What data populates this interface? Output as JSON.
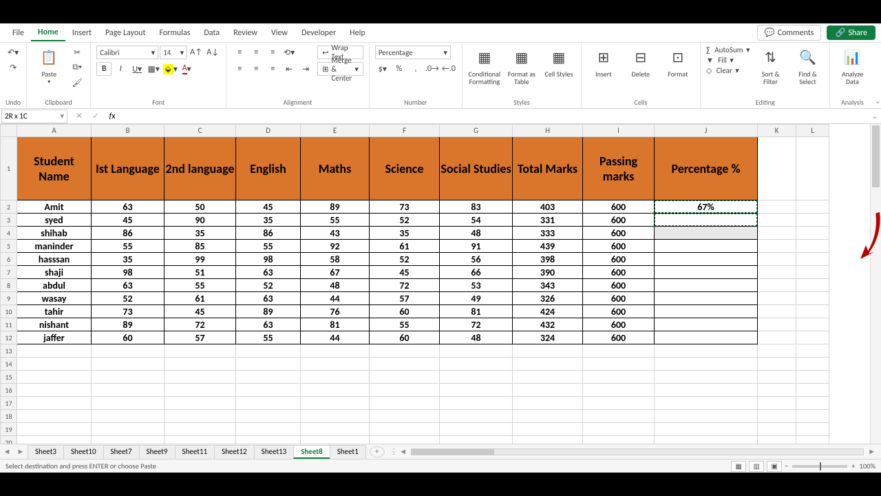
{
  "menu": {
    "tabs": [
      "File",
      "Home",
      "Insert",
      "Page Layout",
      "Formulas",
      "Data",
      "Review",
      "View",
      "Developer",
      "Help"
    ],
    "active": "Home",
    "comments": "Comments",
    "share": "Share"
  },
  "ribbon": {
    "groups": [
      "Undo",
      "Clipboard",
      "Font",
      "Alignment",
      "Number",
      "Styles",
      "Cells",
      "Editing",
      "Analysis"
    ],
    "paste": "Paste",
    "font_name": "Calibri",
    "font_size": "14",
    "wrap": "Wrap Text",
    "merge": "Merge & Center",
    "number_format": "Percentage",
    "cond": "Conditional Formatting",
    "fmtTable": "Format as Table",
    "cellStyles": "Cell Styles",
    "insert": "Insert",
    "delete": "Delete",
    "format": "Format",
    "autosum": "AutoSum",
    "fill": "Fill",
    "clear": "Clear",
    "sort": "Sort & Filter",
    "find": "Find & Select",
    "analyze": "Analyze Data"
  },
  "fx": {
    "namebox": "2R x 1C",
    "formula": ""
  },
  "columns_letters": [
    "A",
    "B",
    "C",
    "D",
    "E",
    "F",
    "G",
    "H",
    "I",
    "J",
    "K",
    "L"
  ],
  "headers": [
    "Student Name",
    "Ist Language",
    "2nd language",
    "English",
    "Maths",
    "Science",
    "Social Studies",
    "Total Marks",
    "Passing marks",
    "Percentage %"
  ],
  "rows": [
    {
      "n": "Amit",
      "l1": 63,
      "l2": 50,
      "en": 45,
      "ma": 89,
      "sc": 73,
      "ss": 83,
      "tot": 403,
      "pm": 600,
      "pct": "67%"
    },
    {
      "n": "syed",
      "l1": 45,
      "l2": 90,
      "en": 35,
      "ma": 55,
      "sc": 52,
      "ss": 54,
      "tot": 331,
      "pm": 600,
      "pct": ""
    },
    {
      "n": "shihab",
      "l1": 86,
      "l2": 35,
      "en": 86,
      "ma": 43,
      "sc": 35,
      "ss": 48,
      "tot": 333,
      "pm": 600,
      "pct": ""
    },
    {
      "n": "maninder",
      "l1": 55,
      "l2": 85,
      "en": 55,
      "ma": 92,
      "sc": 61,
      "ss": 91,
      "tot": 439,
      "pm": 600,
      "pct": ""
    },
    {
      "n": "hasssan",
      "l1": 35,
      "l2": 99,
      "en": 98,
      "ma": 58,
      "sc": 52,
      "ss": 56,
      "tot": 398,
      "pm": 600,
      "pct": ""
    },
    {
      "n": "shaji",
      "l1": 98,
      "l2": 51,
      "en": 63,
      "ma": 67,
      "sc": 45,
      "ss": 66,
      "tot": 390,
      "pm": 600,
      "pct": ""
    },
    {
      "n": "abdul",
      "l1": 63,
      "l2": 55,
      "en": 52,
      "ma": 48,
      "sc": 72,
      "ss": 53,
      "tot": 343,
      "pm": 600,
      "pct": ""
    },
    {
      "n": "wasay",
      "l1": 52,
      "l2": 61,
      "en": 63,
      "ma": 44,
      "sc": 57,
      "ss": 49,
      "tot": 326,
      "pm": 600,
      "pct": ""
    },
    {
      "n": "tahir",
      "l1": 73,
      "l2": 45,
      "en": 89,
      "ma": 76,
      "sc": 60,
      "ss": 81,
      "tot": 424,
      "pm": 600,
      "pct": ""
    },
    {
      "n": "nishant",
      "l1": 89,
      "l2": 72,
      "en": 63,
      "ma": 81,
      "sc": 55,
      "ss": 72,
      "tot": 432,
      "pm": 600,
      "pct": ""
    },
    {
      "n": "jaffer",
      "l1": 60,
      "l2": 57,
      "en": 55,
      "ma": 44,
      "sc": 60,
      "ss": 48,
      "tot": 324,
      "pm": 600,
      "pct": ""
    }
  ],
  "sheet_tabs": [
    "Sheet3",
    "Sheet10",
    "Sheet7",
    "Sheet9",
    "Sheet11",
    "Sheet12",
    "Sheet13",
    "Sheet8",
    "Sheet1"
  ],
  "active_sheet": "Sheet8",
  "status_text": "Select destination and press ENTER or choose Paste",
  "zoom": "100%"
}
